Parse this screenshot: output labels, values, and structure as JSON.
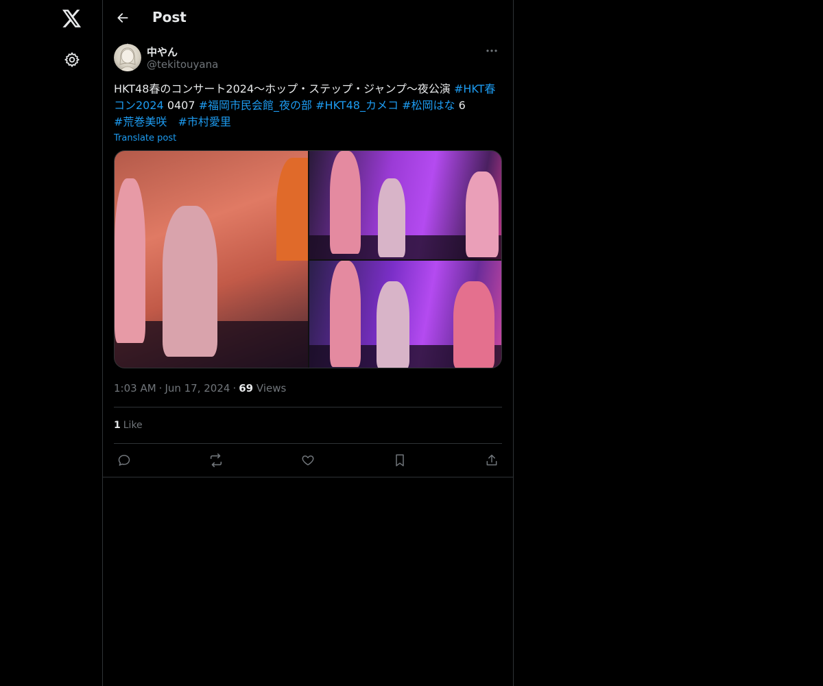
{
  "header": {
    "title": "Post"
  },
  "nav": {
    "logo_icon": "x-logo-icon",
    "settings_icon": "gear-icon"
  },
  "post": {
    "author_name": "中やん",
    "author_handle": "@tekitouyana",
    "text_parts": {
      "t1": "HKT48春のコンサート2024〜ホップ・ステップ・ジャンプ〜夜公演 ",
      "h1": "#HKT春コン2024",
      "t2": " 0407 ",
      "h2": "#福岡市民会館_夜の部",
      "t3": " ",
      "h3": "#HKT48_カメコ",
      "t4": " ",
      "h4": "#松岡はな",
      "t5": " 6 ",
      "h5": "#荒巻美咲",
      "t6": "　",
      "h6": "#市村愛里"
    },
    "translate_label": "Translate post",
    "time": "1:03 AM",
    "date": "Jun 17, 2024",
    "views_count": "69",
    "views_label": "Views",
    "likes_count": "1",
    "likes_label": "Like"
  },
  "colors": {
    "accent": "#1d9bf0",
    "border": "#2f3336",
    "muted": "#71767b",
    "text": "#e7e9ea"
  }
}
